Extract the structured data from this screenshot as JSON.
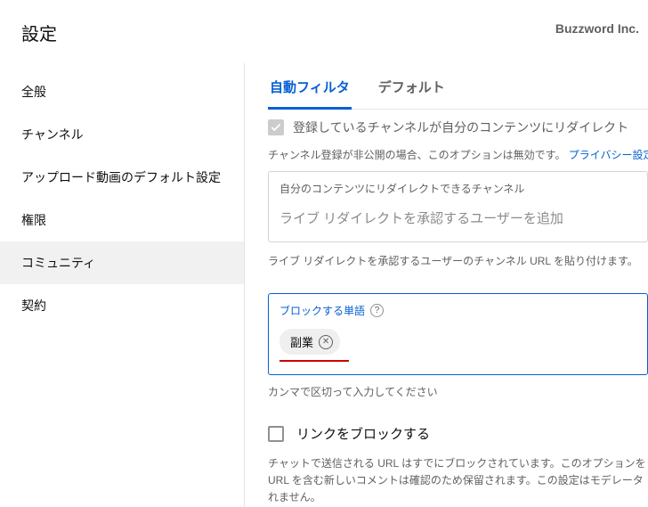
{
  "header": {
    "title": "設定",
    "brand": "Buzzword Inc."
  },
  "sidebar": {
    "items": [
      {
        "label": "全般"
      },
      {
        "label": "チャンネル"
      },
      {
        "label": "アップロード動画のデフォルト設定"
      },
      {
        "label": "権限"
      },
      {
        "label": "コミュニティ"
      },
      {
        "label": "契約"
      }
    ]
  },
  "tabs": {
    "auto_filter": "自動フィルタ",
    "default": "デフォルト"
  },
  "redirect": {
    "checkbox_label": "登録しているチャンネルが自分のコンテンツにリダイレクト",
    "helper_pre": "チャンネル登録が非公開の場合、このオプションは無効です。",
    "helper_link": "プライバシー設定",
    "box_label": "自分のコンテンツにリダイレクトできるチャンネル",
    "box_placeholder": "ライブ リダイレクトを承認するユーザーを追加",
    "box_helper": "ライブ リダイレクトを承認するユーザーのチャンネル URL を貼り付けます。"
  },
  "blocked_words": {
    "title": "ブロックする単語",
    "chip": "副業",
    "helper": "カンマで区切って入力してください"
  },
  "block_links": {
    "label": "リンクをブロックする",
    "desc_l1": "チャットで送信される URL はすでにブロックされています。このオプションを",
    "desc_l2": "URL を含む新しいコメントは確認のため保留されます。この設定はモデレータ",
    "desc_l3": "れません。"
  }
}
